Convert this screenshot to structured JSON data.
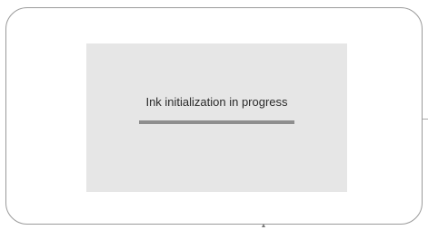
{
  "dialog": {
    "message": "Ink initialization in progress",
    "progress_fraction": 1.0
  },
  "colors": {
    "dialog_background": "#e6e6e6",
    "progress_fill": "#8e8e8e",
    "text": "#2b2b2b"
  }
}
